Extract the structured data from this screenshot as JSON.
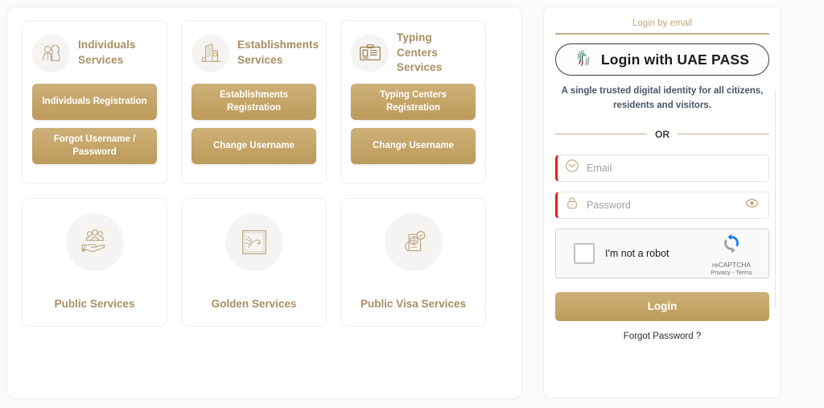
{
  "left_panel": {
    "service_cards": [
      {
        "id": "individuals",
        "icon": "individuals-people-icon",
        "title": "Individuals Services",
        "buttons": [
          {
            "id": "individuals-registration",
            "label": "Individuals Registration"
          },
          {
            "id": "forgot-username-password",
            "label": "Forgot Username / Password"
          }
        ]
      },
      {
        "id": "establishments",
        "icon": "building-icon",
        "title": "Establishments Services",
        "buttons": [
          {
            "id": "establishments-registration",
            "label": "Establishments Registration"
          },
          {
            "id": "establishments-change-username",
            "label": "Change Username"
          }
        ]
      },
      {
        "id": "typing-centers",
        "icon": "id-card-icon",
        "title": "Typing Centers Services",
        "buttons": [
          {
            "id": "typing-centers-registration",
            "label": "Typing Centers Registration"
          },
          {
            "id": "typing-centers-change-username",
            "label": "Change Username"
          }
        ]
      }
    ],
    "link_cards": [
      {
        "id": "public-services",
        "icon": "people-on-hand-icon",
        "label": "Public Services"
      },
      {
        "id": "golden-services",
        "icon": "falcon-frame-icon",
        "label": "Golden Services"
      },
      {
        "id": "public-visa-services",
        "icon": "hand-passport-globe-icon",
        "label": "Public Visa Services"
      }
    ]
  },
  "login_panel": {
    "tab_label": "Login by email",
    "uaepass": {
      "button_label": "Login with UAE PASS",
      "icon": "fingerprint-icon",
      "description": "A single trusted digital identity for all citizens, residents and visitors."
    },
    "divider_label": "OR",
    "fields": [
      {
        "id": "email",
        "icon": "envelope-icon",
        "placeholder": "Email",
        "value": ""
      },
      {
        "id": "password",
        "icon": "lock-icon",
        "placeholder": "Password",
        "value": "",
        "toggle_icon": "eye-icon"
      }
    ],
    "captcha": {
      "checkbox_label": "I'm not a robot",
      "brand_name": "reCAPTCHA",
      "brand_terms": "Privacy - Terms",
      "logo_icon": "recaptcha-logo-icon"
    },
    "login_button_label": "Login",
    "forgot_password_label": "Forgot Password ?"
  },
  "theme": {
    "gold": "#c5a467",
    "gold_text": "#a98e63",
    "tab_gold": "#c4a87c",
    "required_red": "#e01f1f",
    "page_bg": "#fafafa",
    "panel_bg": "#ffffff"
  }
}
